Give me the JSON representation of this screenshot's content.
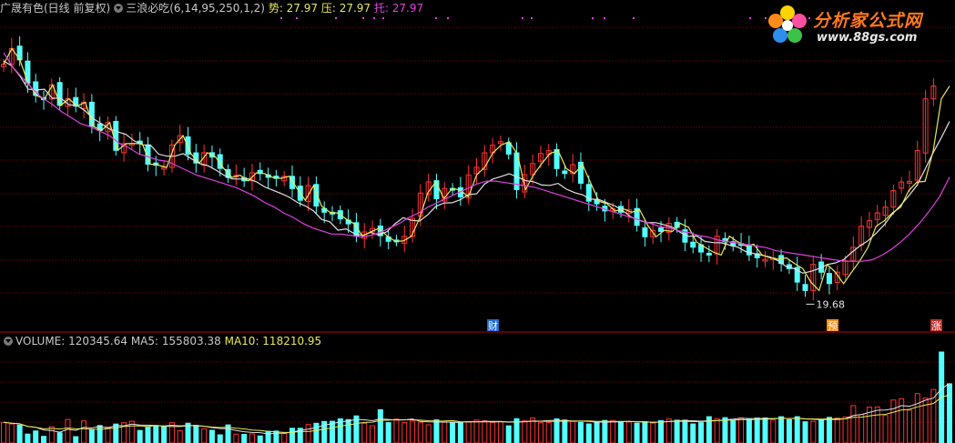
{
  "header": {
    "stock_title": "广晟有色(日线 前复权)",
    "indicator_title": "三浪必吃(6,14,95,250,1,2)",
    "shi_label": "势: 27.97",
    "ya_label": "压: 27.97",
    "tuo_label": "托: 27.97"
  },
  "volume_header": {
    "label": "VOLUME: 120345.64",
    "ma5": "MA5: 155803.38",
    "ma10": "MA10: 118210.95"
  },
  "logo": {
    "brand": "分析家公式网",
    "url": "www.88gs.com"
  },
  "markers": {
    "low_price": "19.68",
    "cai": "财",
    "yu": "预",
    "zhang": "涨"
  },
  "colors": {
    "up": "#ff3232",
    "down": "#54ffff",
    "yellow_line": "#e8e85a",
    "white_line": "#e0e0e0",
    "magenta_line": "#e040e0",
    "grid": "#8b0000",
    "marker_box": "#ff8c1a",
    "marker_blue": "#1e6ad6",
    "marker_red": "#c0302a"
  },
  "chart_data": [
    {
      "type": "candlestick",
      "series": [
        {
          "name": "势",
          "values": [
            35.43,
            36.47,
            35.72,
            34.19,
            33.37,
            33.13,
            34.06,
            32.71,
            33.15,
            32.66,
            32.92,
            31.33,
            31.05,
            31.57,
            29.74,
            30.18,
            30.19,
            30.17,
            28.82,
            28.75,
            28.61,
            30.09,
            30.71,
            29.49,
            28.9,
            29.58,
            29.29,
            28.54,
            27.94,
            28.09,
            27.72,
            28.25,
            28.2,
            27.95,
            27.88,
            28.02,
            27.21,
            26.43,
            27.4,
            26.05,
            25.64,
            25.58,
            25.2,
            24.87,
            24.07,
            24.34,
            24.57,
            24.09,
            23.72,
            23.74,
            24.05,
            25.23,
            26.91,
            27.65,
            26.54,
            27.22,
            27.11,
            26.66,
            28.11,
            28.62,
            29.57,
            30.08,
            30.31,
            29.49,
            27.14,
            28.13,
            28.86,
            29.53,
            29.71,
            28.53,
            28.2,
            28.79,
            27.56,
            26.37,
            26.2,
            25.73,
            25.87,
            25.64,
            25.81,
            24.77,
            24.02,
            24.44,
            24.37,
            24.9,
            24.64,
            23.66,
            23.33,
            23.01,
            22.81,
            24.06,
            23.69,
            23.41,
            23.53,
            22.82,
            22.63,
            22.53,
            22.62,
            22.25,
            21.91,
            21.02,
            20.46,
            22.19,
            21.67,
            20.92,
            21.68,
            22.43,
            23.32,
            24.72,
            25.08,
            25.6,
            25.98,
            27.07,
            27.64,
            27.68,
            29.72,
            33.14,
            33.99
          ]
        },
        {
          "name": "压",
          "values": [
            35.65,
            35.32,
            34.65,
            33.78,
            33.73,
            33.78,
            33.18,
            33.2,
            32.75,
            32.71,
            32.35,
            31.83,
            31.5,
            31.14,
            30.96,
            30.79,
            30.37,
            30.1,
            30.09,
            29.49,
            29.35,
            29.35,
            29.52,
            29.19,
            28.87,
            28.73,
            28.44,
            28.1,
            27.85,
            27.84,
            27.85,
            27.65,
            27.32,
            27.1,
            26.89,
            26.65,
            26.3,
            26.06,
            25.73,
            25.17,
            25.01,
            24.45,
            24.54,
            24.23,
            24.1,
            24.3,
            24.13,
            24.35,
            24.88,
            25.28,
            25.11,
            25.06,
            25.47,
            26.03,
            26.25,
            26.27,
            26.47,
            26.81,
            26.86,
            27.52,
            27.84,
            28.0,
            28.19,
            27.98,
            27.73,
            27.66,
            27.44,
            27.42,
            27.55,
            27.17,
            26.94,
            26.79,
            26.51,
            26.48,
            26.27,
            26.05,
            25.71,
            25.31,
            25.09,
            24.96,
            24.95,
            24.81,
            24.65,
            24.3,
            24.05,
            24.07,
            23.71,
            23.63,
            23.62,
            23.47,
            23.34,
            23.04,
            22.91,
            22.79,
            22.69,
            22.42,
            22.04,
            21.9,
            21.61,
            21.73,
            21.91,
            22.18,
            22.29,
            22.5,
            22.98,
            23.41,
            23.76,
            24.25,
            24.81,
            25.53,
            26.1,
            26.72,
            27.42,
            28.48,
            29.59,
            30.58,
            31.65
          ]
        },
        {
          "name": "托",
          "values": [
            36.2,
            35.2,
            34.5,
            33.8,
            33.2,
            32.8,
            32.3,
            31.9,
            31.5,
            31.3,
            31.0,
            30.7,
            30.2,
            29.9,
            29.5,
            29.3,
            29.1,
            29.0,
            28.7,
            28.4,
            28.1,
            27.9,
            27.7,
            27.5,
            27.3,
            27.0,
            26.7,
            26.3,
            26.0,
            25.6,
            25.3,
            24.9,
            24.6,
            24.4,
            24.2,
            24.2,
            24.1,
            24.0,
            24.1,
            24.3,
            24.6,
            24.9,
            25.3,
            25.6,
            26.0,
            26.3,
            26.6,
            26.9,
            27.2,
            27.5,
            27.7,
            27.7,
            27.6,
            27.5,
            27.4,
            27.3,
            27.1,
            26.9,
            26.7,
            26.5,
            26.3,
            26.1,
            25.9,
            25.7,
            25.5,
            25.3,
            25.1,
            24.9,
            24.7,
            24.6,
            24.4,
            24.3,
            24.1,
            24.0,
            23.8,
            23.7,
            23.6,
            23.5,
            23.4,
            23.3,
            23.1,
            23.0,
            22.9,
            22.8,
            22.7,
            22.6,
            22.5,
            22.4,
            22.4,
            22.4,
            22.5,
            22.8,
            23.2,
            23.7,
            24.3,
            25.0,
            25.8,
            26.7,
            27.97
          ]
        }
      ],
      "low_annotation": 19.68,
      "ylim": [
        18.8,
        38.6
      ]
    },
    {
      "type": "bar",
      "series": [
        {
          "name": "VOLUME",
          "values": [
            14651,
            13500,
            12730,
            6310,
            8530,
            4720,
            11550,
            7210,
            16670,
            4500,
            15650,
            9290,
            12400,
            11320,
            13440,
            14330,
            15430,
            8890,
            11180,
            12380,
            11660,
            14380,
            8750,
            14020,
            12510,
            10110,
            9010,
            5780,
            12830,
            6280,
            6090,
            6450,
            5010,
            8320,
            8460,
            6700,
            10440,
            10450,
            13090,
            13960,
            15260,
            15420,
            17160,
            16600,
            19180,
            13950,
            12230,
            23580,
            14440,
            17000,
            14600,
            15560,
            14760,
            12890,
            16400,
            14760,
            14730,
            14810,
            14890,
            16250,
            15760,
            14570,
            15130,
            12160,
            17220,
            15860,
            17700,
            14340,
            14470,
            17110,
            16300,
            15320,
            14580,
            13510,
            14510,
            16000,
            16000,
            14840,
            14940,
            14000,
            15100,
            14110,
            15860,
            16990,
            16180,
            16220,
            13520,
            14410,
            18650,
            17240,
            17990,
            16130,
            17720,
            17230,
            17700,
            17770,
            16210,
            18630,
            16440,
            18670,
            15050,
            15400,
            16530,
            18180,
            17690,
            18450,
            26480,
            20110,
            25440,
            25540,
            19520,
            30470,
            31340,
            23290,
            34980,
            31830,
            37930,
            64460,
            41940
          ]
        },
        {
          "name": "MA5",
          "values": [
            155803.38
          ]
        },
        {
          "name": "MA10",
          "values": [
            118210.95
          ]
        }
      ]
    }
  ]
}
